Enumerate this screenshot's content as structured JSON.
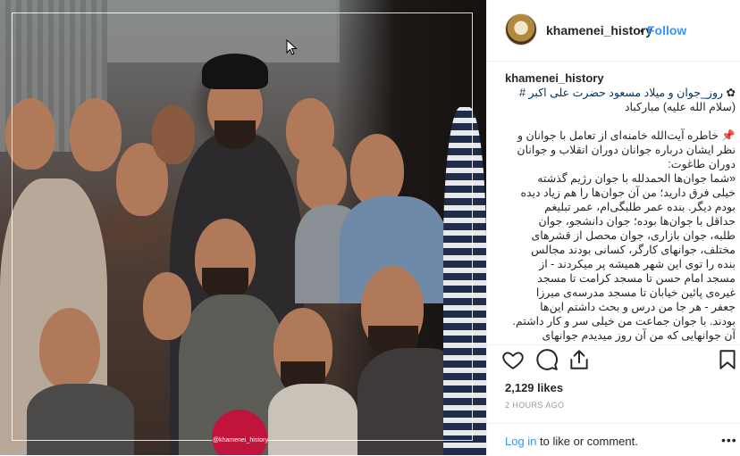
{
  "photo": {
    "watermark": "@khamenei_history"
  },
  "header": {
    "username": "khamenei_history",
    "separator": "•",
    "follow_label": "Follow",
    "avatar_icon": "profile-portrait-icon"
  },
  "caption": {
    "username": "khamenei_history",
    "lines": [
      {
        "prefix": "✿",
        "text": " روز_جوان و میلاد مسعود حضرت علی اکبر ",
        "tag": "#"
      },
      {
        "text": "(سلام الله علیه) مبارکباد"
      },
      {
        "text": ""
      },
      {
        "text": "📌 خاطره آیت‌الله خامنه‌ای از تعامل با جوانان و"
      },
      {
        "text": "نظر ایشان درباره جوانان دوران انقلاب و جوانان"
      },
      {
        "text": "دوران طاغوت:"
      },
      {
        "text": "«شما جوان‌ها الحمدلله با جوان رژیم گذشته"
      },
      {
        "text": "خیلی فرق دارید؛ من آن جوان‌ها را هم زیاد دیده"
      },
      {
        "text": "بودم دیگر. بنده عمر طلبگی‌ام، عمر تبلیغم"
      },
      {
        "text": "حداقل با جوان‌ها بوده؛ جوان دانشجو، جوان"
      },
      {
        "text": "طلبه، جوان بازاری، جوان محصل از قشرهای"
      },
      {
        "text": "مختلف، جوانهای کارگر، کسانی بودند مجالس"
      },
      {
        "text": "بنده را توی این شهر همیشه پر میکردند - از"
      },
      {
        "text": "مسجد امام حسن تا مسجد کرامت تا مسجد"
      },
      {
        "text": "غیره‌ی پائین خیابان تا مسجد مدرسه‌ی میرزا"
      },
      {
        "text": "جعفر - هر جا من درس و بحث داشتم این‌ها"
      },
      {
        "text": "بودند. با جوان جماعت من خیلی سر و کار داشتم."
      },
      {
        "text": "آن جوانهایی که من آن روز میدیدم جوانهای"
      }
    ]
  },
  "actions": {
    "like_icon": "heart-icon",
    "comment_icon": "comment-bubble-icon",
    "share_icon": "share-upload-icon",
    "save_icon": "bookmark-icon"
  },
  "likes": "2,129 likes",
  "timestamp": "2 HOURS AGO",
  "footer": {
    "login_link": "Log in",
    "login_rest": " to like or comment.",
    "more": "•••"
  },
  "colors": {
    "link": "#3897f0",
    "hashtag": "#003569",
    "watermark": "#c0143c"
  }
}
